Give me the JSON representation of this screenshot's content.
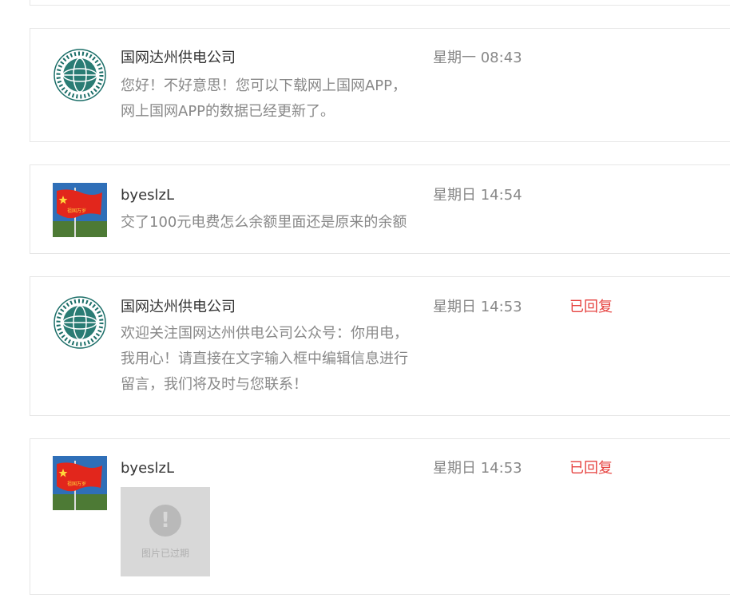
{
  "messages": [
    {
      "name": "国网达州供电公司",
      "time": "星期一 08:43",
      "avatar": "state-grid-logo",
      "lines": [
        "您好！不好意思！您可以下载网上国网APP，",
        "网上国网APP的数据已经更新了。"
      ]
    },
    {
      "name": "byeslzL",
      "time": "星期日 14:54",
      "avatar": "china-flag-photo",
      "lines": [
        "交了100元电费怎么余额里面还是原来的余额"
      ]
    },
    {
      "name": "国网达州供电公司",
      "time": "星期日 14:53",
      "status": "已回复",
      "avatar": "state-grid-logo",
      "lines": [
        "欢迎关注国网达州供电公司公众号：你用电，",
        "我用心！请直接在文字输入框中编辑信息进行",
        "留言，我们将及时与您联系！"
      ]
    },
    {
      "name": "byeslzL",
      "time": "星期日 14:53",
      "status": "已回复",
      "avatar": "china-flag-photo",
      "image_expired_label": "图片已过期"
    }
  ],
  "colors": {
    "status": "#e64340",
    "name": "#333333",
    "meta": "#888888",
    "border": "#e6e6e6"
  }
}
